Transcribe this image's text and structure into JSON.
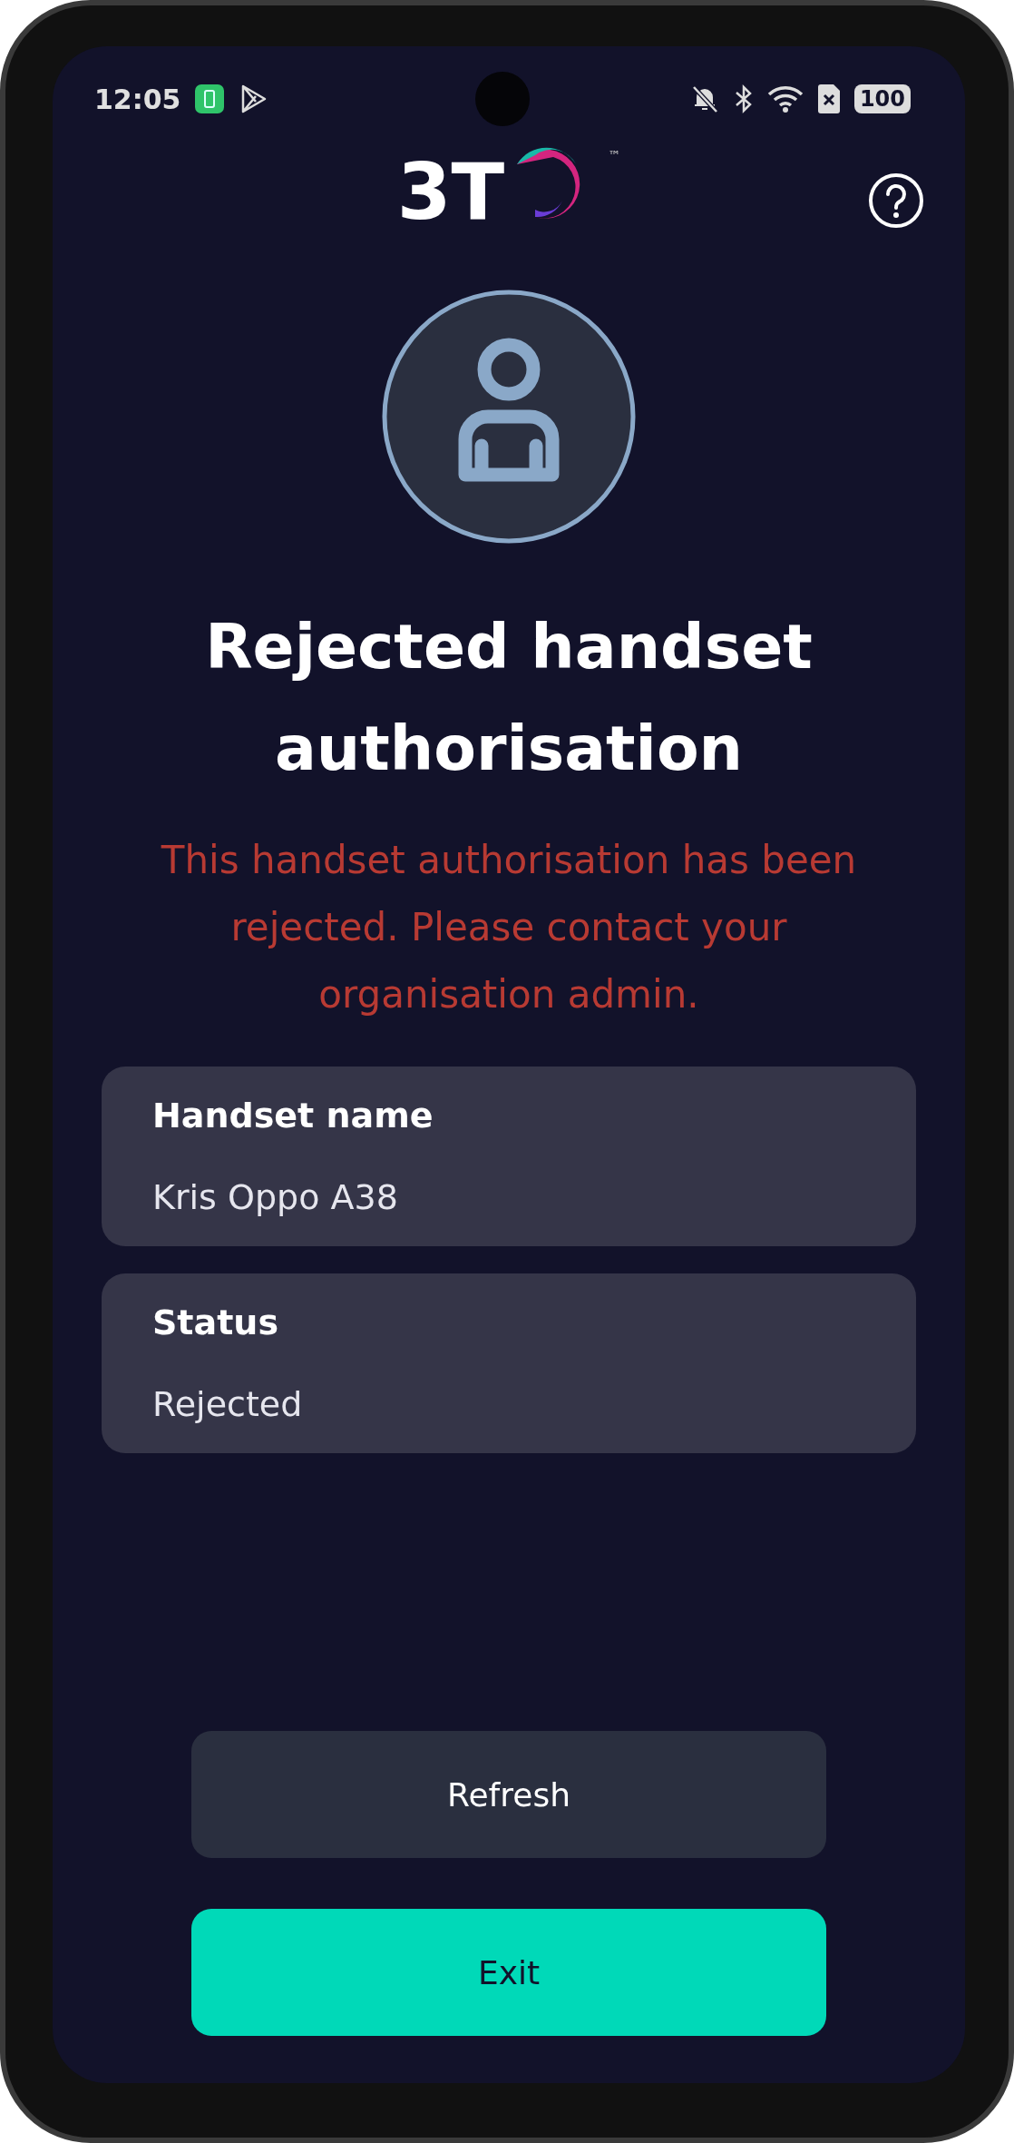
{
  "status_bar": {
    "time": "12:05",
    "battery": "100"
  },
  "header": {
    "logo": "3T",
    "logo_mark": "™"
  },
  "title": "Rejected handset authorisation",
  "message": "This handset authorisation has been rejected. Please contact your organisation admin.",
  "fields": [
    {
      "label": "Handset name",
      "value": "Kris Oppo A38"
    },
    {
      "label": "Status",
      "value": "Rejected"
    }
  ],
  "buttons": [
    {
      "label": "Refresh",
      "kind": "secondary"
    },
    {
      "label": "Exit",
      "kind": "primary"
    }
  ]
}
